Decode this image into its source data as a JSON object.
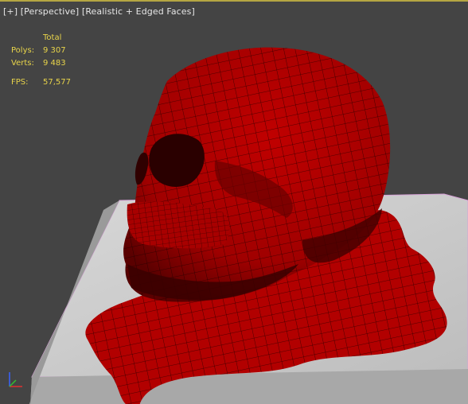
{
  "viewport": {
    "label": {
      "plus": "[+]",
      "view": "[Perspective]",
      "shading": "[Realistic + Edged Faces]"
    },
    "stats": {
      "header": "Total",
      "polys_label": "Polys:",
      "polys_value": "9 307",
      "verts_label": "Verts:",
      "verts_value": "9 483",
      "fps_label": "FPS:",
      "fps_value": "57,577"
    },
    "colors": {
      "background": "#444444",
      "active_border": "#b5a642",
      "stats_text": "#e8d44a",
      "model": "#b40000",
      "box": "#c4c4c4",
      "wire": "#1a0000"
    }
  }
}
